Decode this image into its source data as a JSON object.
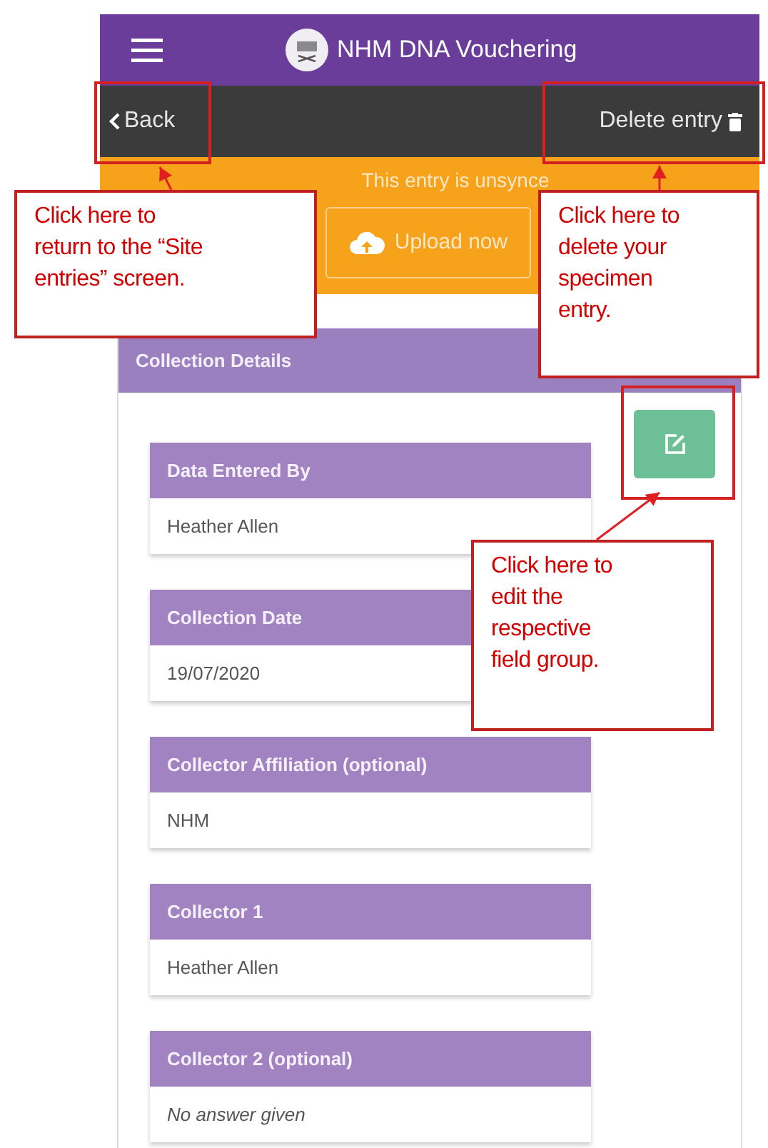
{
  "app_bar": {
    "title": "NHM DNA Vouchering"
  },
  "nav_bar": {
    "back": "Back",
    "delete": "Delete entry"
  },
  "sync_banner": {
    "message": "This entry is unsynce",
    "button": "Upload now"
  },
  "section": {
    "title": "Collection Details"
  },
  "fields": [
    {
      "label": "Data Entered By",
      "value": "Heather Allen",
      "answered": true
    },
    {
      "label": "Collection Date",
      "value": "19/07/2020",
      "answered": true
    },
    {
      "label": "Collector Affiliation (optional)",
      "value": "NHM",
      "answered": true
    },
    {
      "label": "Collector 1",
      "value": "Heather Allen",
      "answered": true
    },
    {
      "label": "Collector 2 (optional)",
      "value": "No answer given",
      "answered": false
    }
  ],
  "callouts": [
    {
      "lines": [
        "Click here to",
        "return to the “Site",
        "entries” screen."
      ],
      "kind": "back"
    },
    {
      "lines": [
        "Click here to",
        "delete your",
        "specimen",
        "entry."
      ],
      "kind": "delete"
    },
    {
      "lines": [
        "Click here to",
        "edit the",
        "respective",
        "field group."
      ],
      "kind": "edit"
    }
  ]
}
